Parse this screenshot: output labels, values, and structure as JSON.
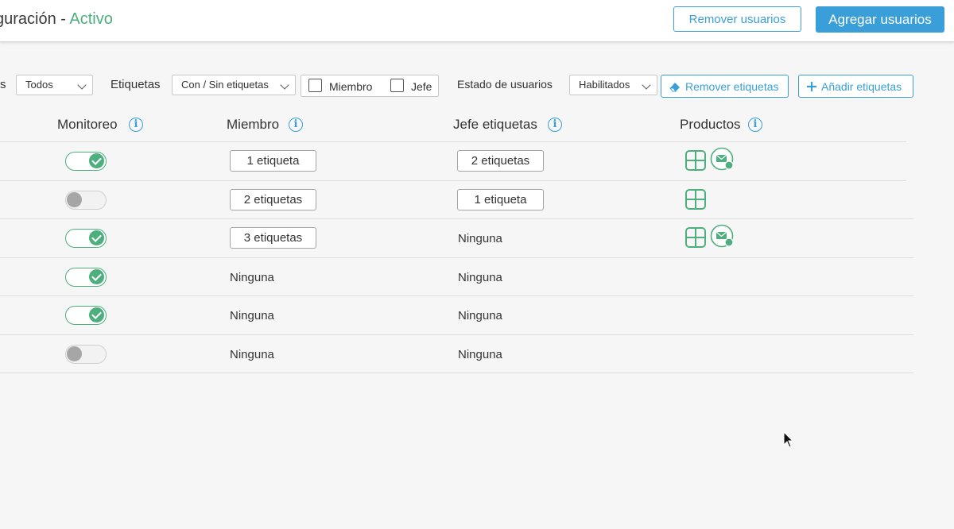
{
  "header": {
    "title_prefix": "guración - ",
    "title_status": "Activo",
    "remove_users_label": "Remover usuarios",
    "add_users_label": "Agregar usuarios"
  },
  "filters": {
    "first_label_fragment": "s",
    "first_select": "Todos",
    "tags_label": "Etiquetas",
    "tags_select": "Con / Sin etiquetas",
    "member_label": "Miembro",
    "boss_label": "Jefe",
    "user_state_label": "Estado de usuarios",
    "user_state_select": "Habilitados",
    "remove_tags_label": "Remover etiquetas",
    "add_tags_label": "Añadir etiquetas"
  },
  "columns": {
    "monitoring": "Monitoreo",
    "member": "Miembro",
    "boss_tags": "Jefe etiquetas",
    "products": "Productos"
  },
  "rows": [
    {
      "monitoring_on": true,
      "member": "1 etiqueta",
      "member_is_button": true,
      "boss": "2 etiquetas",
      "boss_is_button": true,
      "products": [
        "grid-product-icon",
        "mail-product-icon"
      ]
    },
    {
      "monitoring_on": false,
      "member": "2 etiquetas",
      "member_is_button": true,
      "boss": "1 etiqueta",
      "boss_is_button": true,
      "products": [
        "grid-product-icon"
      ]
    },
    {
      "monitoring_on": true,
      "member": "3 etiquetas",
      "member_is_button": true,
      "boss": "Ninguna",
      "boss_is_button": false,
      "products": [
        "grid-product-icon",
        "mail-product-icon"
      ]
    },
    {
      "monitoring_on": true,
      "member": "Ninguna",
      "member_is_button": false,
      "boss": "Ninguna",
      "boss_is_button": false,
      "products": []
    },
    {
      "monitoring_on": true,
      "member": "Ninguna",
      "member_is_button": false,
      "boss": "Ninguna",
      "boss_is_button": false,
      "products": []
    },
    {
      "monitoring_on": false,
      "member": "Ninguna",
      "member_is_button": false,
      "boss": "Ninguna",
      "boss_is_button": false,
      "products": []
    }
  ],
  "colors": {
    "accent": "#3a9fd8",
    "success": "#4caf7d"
  },
  "icons": {
    "info": "info-icon",
    "eraser": "eraser-icon",
    "plus": "plus-icon",
    "chevron": "chevron-down-icon",
    "cursor": "mouse-pointer-icon"
  }
}
